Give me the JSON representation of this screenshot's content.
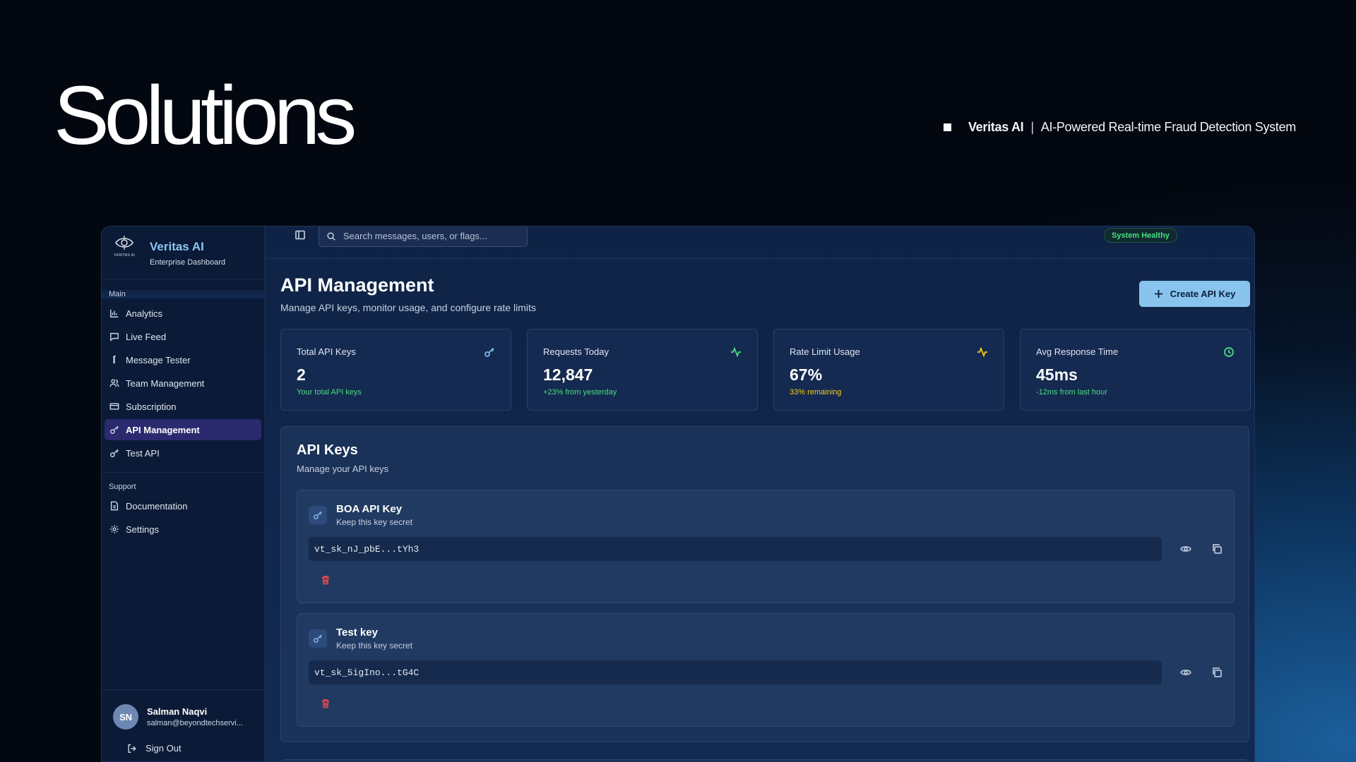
{
  "hero": {
    "title": "Solutions",
    "brand_name": "Veritas AI",
    "separator": "|",
    "tagline": "AI-Powered Real-time Fraud Detection System"
  },
  "sidebar": {
    "logo_text": "VERITAS AI",
    "title": "Veritas AI",
    "subtitle": "Enterprise Dashboard",
    "main_label": "Main",
    "main_items": [
      {
        "label": "Analytics",
        "icon": "bar-chart-icon"
      },
      {
        "label": "Live Feed",
        "icon": "message-square-icon"
      },
      {
        "label": "Message Tester",
        "icon": "test-tube-icon"
      },
      {
        "label": "Team Management",
        "icon": "users-icon"
      },
      {
        "label": "Subscription",
        "icon": "credit-card-icon"
      },
      {
        "label": "API Management",
        "icon": "key-icon",
        "active": true
      },
      {
        "label": "Test API",
        "icon": "key-icon"
      }
    ],
    "support_label": "Support",
    "support_items": [
      {
        "label": "Documentation",
        "icon": "file-text-icon"
      },
      {
        "label": "Settings",
        "icon": "gear-icon"
      }
    ],
    "user": {
      "initials": "SN",
      "name": "Salman Naqvi",
      "email": "salman@beyondtechservi...",
      "signout_label": "Sign Out"
    }
  },
  "topbar": {
    "search_placeholder": "Search messages, users, or flags...",
    "status": "System Healthy"
  },
  "page": {
    "title": "API Management",
    "subtitle": "Manage API keys, monitor usage, and configure rate limits",
    "create_button": "Create API Key"
  },
  "stats": [
    {
      "label": "Total API Keys",
      "value": "2",
      "note": "Your total API keys",
      "note_color": "#4ade80",
      "icon": "key-icon",
      "icon_color": "#7fb6ea"
    },
    {
      "label": "Requests Today",
      "value": "12,847",
      "note": "+23% from yesterday",
      "note_color": "#4ade80",
      "icon": "activity-icon",
      "icon_color": "#4ade80"
    },
    {
      "label": "Rate Limit Usage",
      "value": "67%",
      "note": "33% remaining",
      "note_color": "#facc15",
      "icon": "activity-icon",
      "icon_color": "#facc15"
    },
    {
      "label": "Avg Response Time",
      "value": "45ms",
      "note": "-12ms from last hour",
      "note_color": "#4ade80",
      "icon": "clock-icon",
      "icon_color": "#4ade80"
    }
  ],
  "keys_panel": {
    "title": "API Keys",
    "subtitle": "Manage your API keys",
    "keys": [
      {
        "name": "BOA API Key",
        "hint": "Keep this key secret",
        "value": "vt_sk_nJ_pbE...tYh3"
      },
      {
        "name": "Test key",
        "hint": "Keep this key secret",
        "value": "vt_sk_5igIno...tG4C"
      }
    ]
  }
}
